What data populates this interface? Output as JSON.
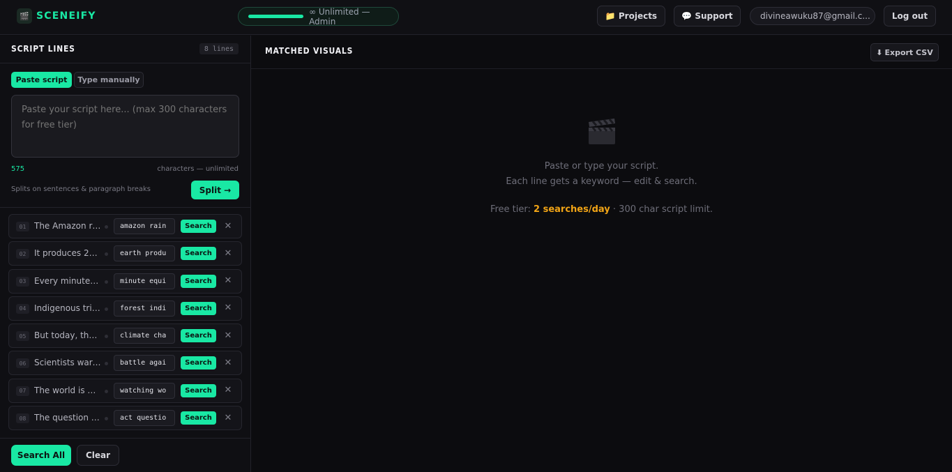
{
  "header": {
    "app_name": "SCENEIFY",
    "logo_glyph": "🎬",
    "plan_label": "∞ Unlimited — Admin",
    "projects_label": "Projects",
    "support_label": "Support",
    "email": "divineawuku87@gmail.c...",
    "logout_label": "Log out"
  },
  "script_panel": {
    "title": "SCRIPT LINES",
    "line_count": "8 lines",
    "tabs": [
      "Paste script",
      "Type manually"
    ],
    "active_tab": "Paste script",
    "textarea_placeholder": "Paste your script here... (max 300 characters for free tier)",
    "char_count": "575",
    "char_note": "characters — unlimited",
    "split_note": "Splits on sentences & paragraph breaks",
    "split_label": "Split →",
    "search_all_label": "Search All",
    "clear_label": "Clear"
  },
  "lines": [
    {
      "num": "01",
      "text": "The Amazon rai...",
      "keyword": "amazon rain"
    },
    {
      "num": "02",
      "text": "It produces 20 ...",
      "keyword": "earth produ"
    },
    {
      "num": "03",
      "text": "Every minute, t...",
      "keyword": "minute equi"
    },
    {
      "num": "04",
      "text": "Indigenous trib...",
      "keyword": "forest indi"
    },
    {
      "num": "05",
      "text": "But today, thei...",
      "keyword": "climate cha"
    },
    {
      "num": "06",
      "text": "Scientists warn...",
      "keyword": "battle agai"
    },
    {
      "num": "07",
      "text": "The world is wa...",
      "keyword": "watching wo"
    },
    {
      "num": "08",
      "text": "The question is...",
      "keyword": "act questio"
    }
  ],
  "line_actions": {
    "search_label": "Search",
    "remove_glyph": "✕"
  },
  "visuals_panel": {
    "title": "MATCHED VISUALS",
    "export_label": "Export CSV",
    "empty_line1": "Paste or type your script.",
    "empty_line2": "Each line gets a keyword — edit & search.",
    "tier_prefix": "Free tier:",
    "tier_highlight": "2 searches/day",
    "tier_suffix": "· 300 char script limit."
  },
  "colors": {
    "accent": "#19e8a4",
    "warning": "#f2a516",
    "background": "#0d0d10"
  }
}
